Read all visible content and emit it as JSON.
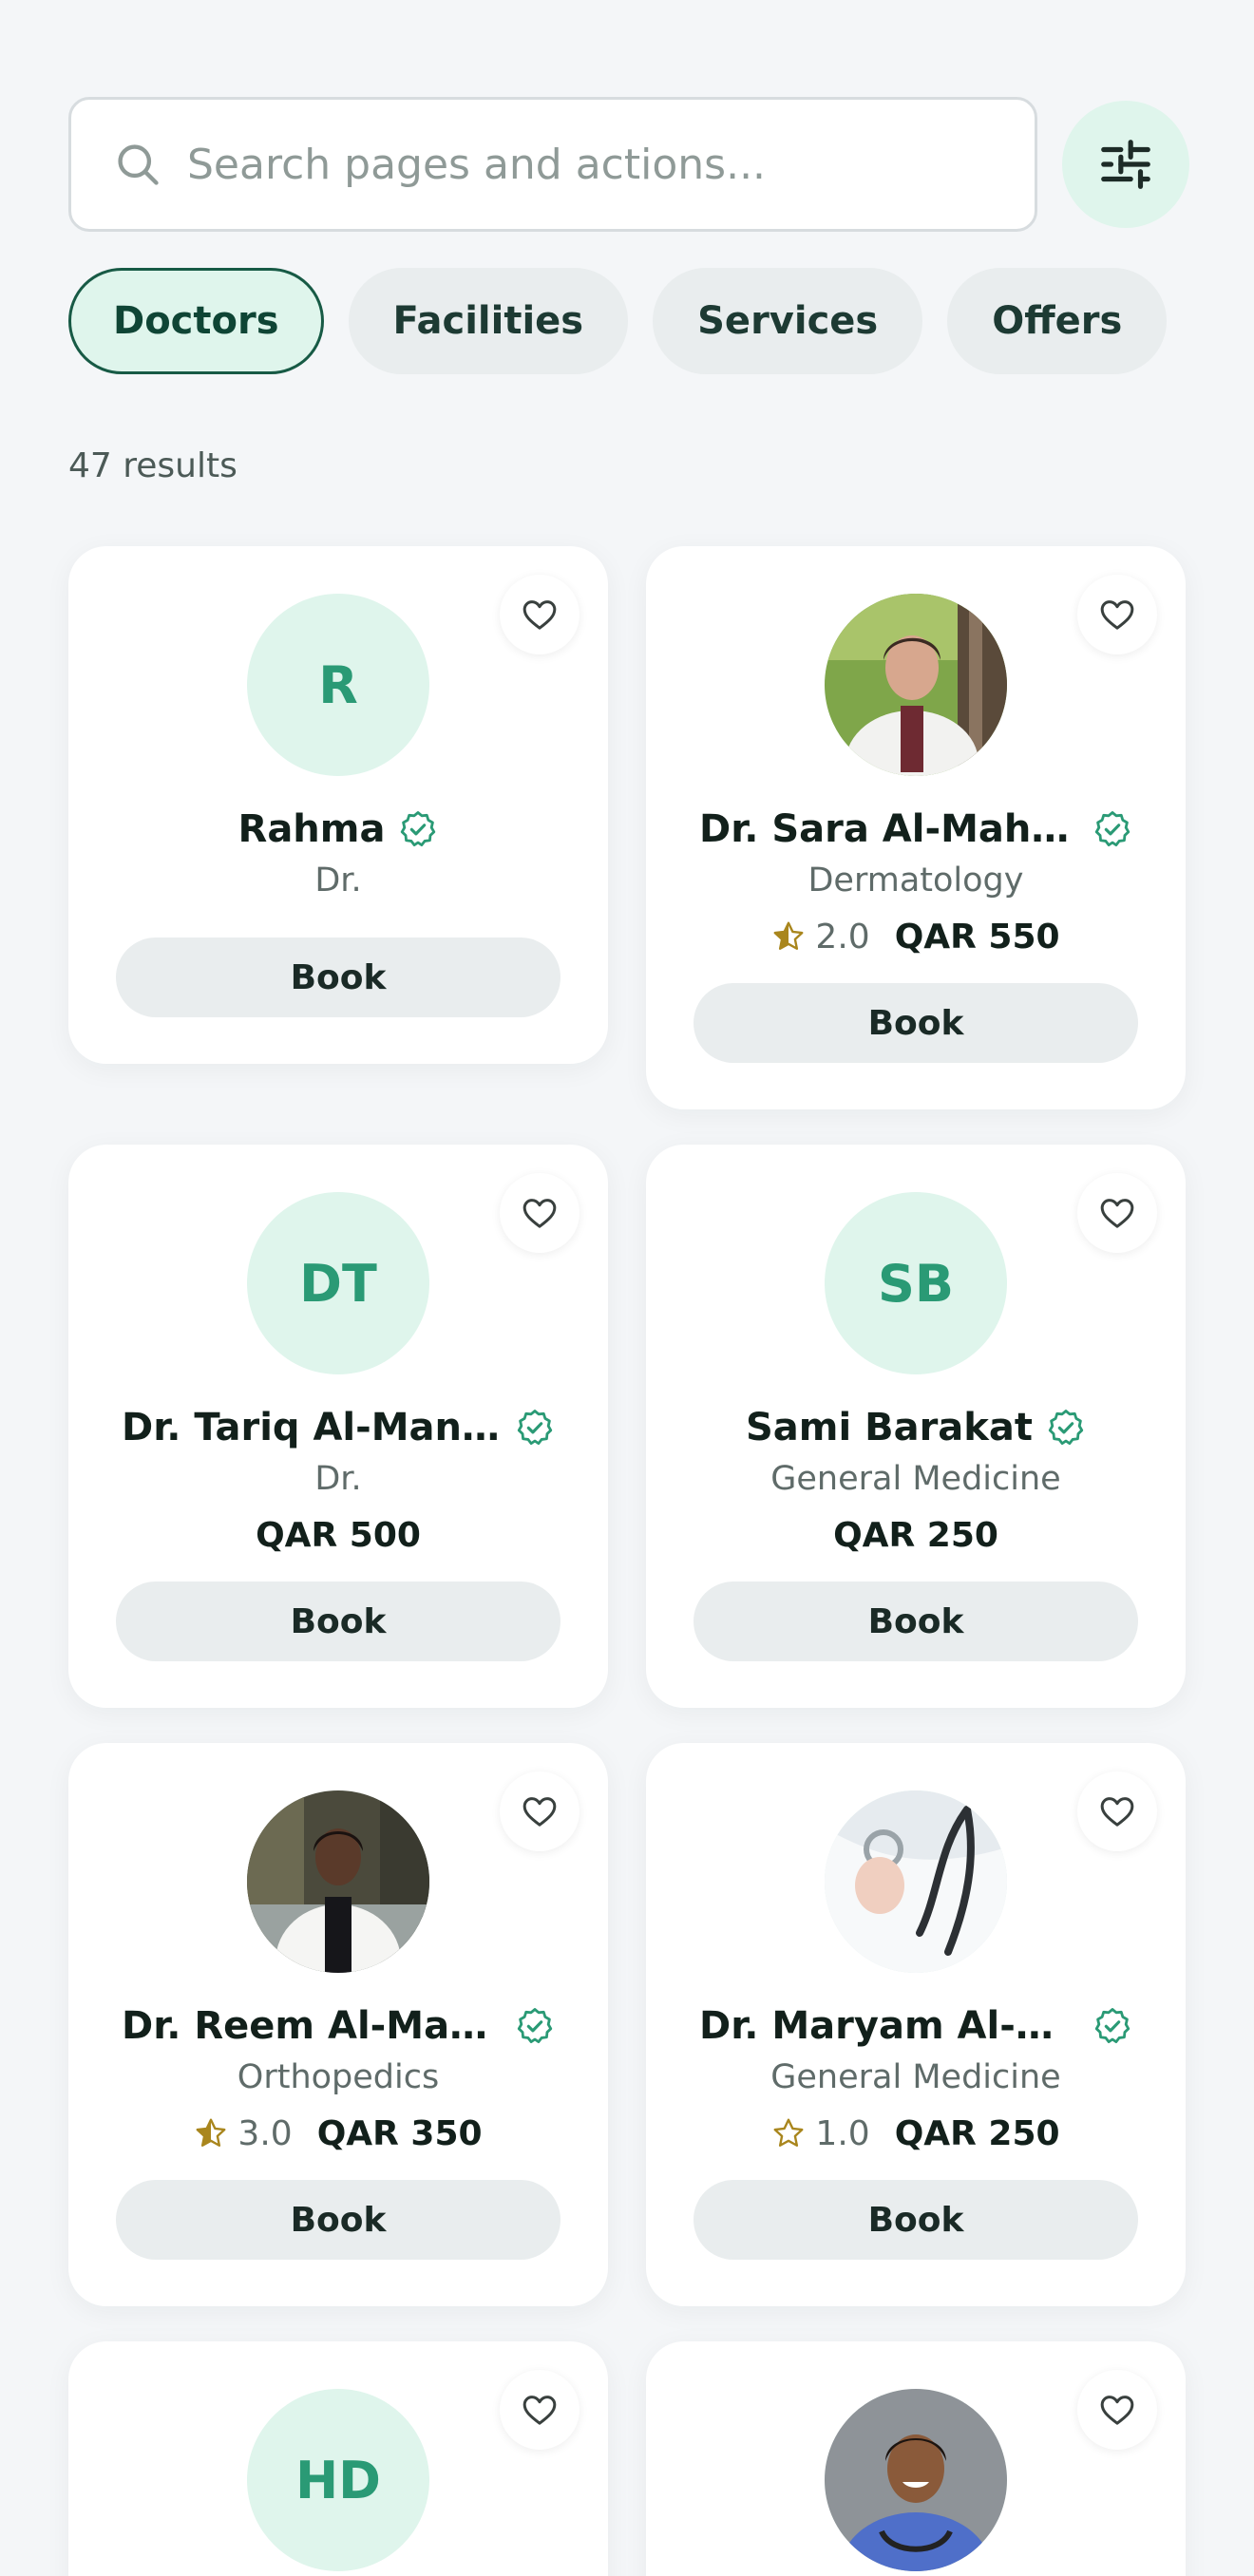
{
  "search": {
    "placeholder": "Search pages and actions..."
  },
  "tabs": [
    {
      "label": "Doctors",
      "active": true
    },
    {
      "label": "Facilities",
      "active": false
    },
    {
      "label": "Services",
      "active": false
    },
    {
      "label": "Offers",
      "active": false
    }
  ],
  "results_label": "47 results",
  "book_label": "Book",
  "colors": {
    "accent": "#2a9a75",
    "accent_bg": "#dff5ec",
    "star": "#a9861d",
    "page_bg": "#f4f6f8"
  },
  "icons": {
    "search": "search-icon",
    "filter": "sliders-icon",
    "favorite": "heart-icon",
    "verified": "verified-check-icon",
    "rating": "star-icon"
  },
  "doctors": [
    {
      "initials": "R",
      "name": "Rahma",
      "specialty": "Dr.",
      "rating": "",
      "price": ""
    },
    {
      "initials": "",
      "name": "Dr. Sara Al-Mahm...",
      "specialty": "Dermatology",
      "rating": "2.0",
      "rating_value": 2.0,
      "price": "QAR 550"
    },
    {
      "initials": "DT",
      "name": "Dr. Tariq Al-Mans...",
      "specialty": "Dr.",
      "rating": "",
      "price": "QAR 500"
    },
    {
      "initials": "SB",
      "name": "Sami Barakat",
      "specialty": "General Medicine",
      "rating": "",
      "price": "QAR 250"
    },
    {
      "initials": "",
      "name": "Dr. Reem Al-Mannai",
      "specialty": "Orthopedics",
      "rating": "3.0",
      "rating_value": 3.0,
      "price": "QAR 350"
    },
    {
      "initials": "",
      "name": "Dr. Maryam Al-Att...",
      "specialty": "General Medicine",
      "rating": "1.0",
      "rating_value": 1.0,
      "price": "QAR 250"
    },
    {
      "initials": "HD",
      "name": "",
      "specialty": "",
      "rating": "",
      "price": ""
    },
    {
      "initials": "",
      "name": "",
      "specialty": "",
      "rating": "",
      "price": ""
    }
  ]
}
